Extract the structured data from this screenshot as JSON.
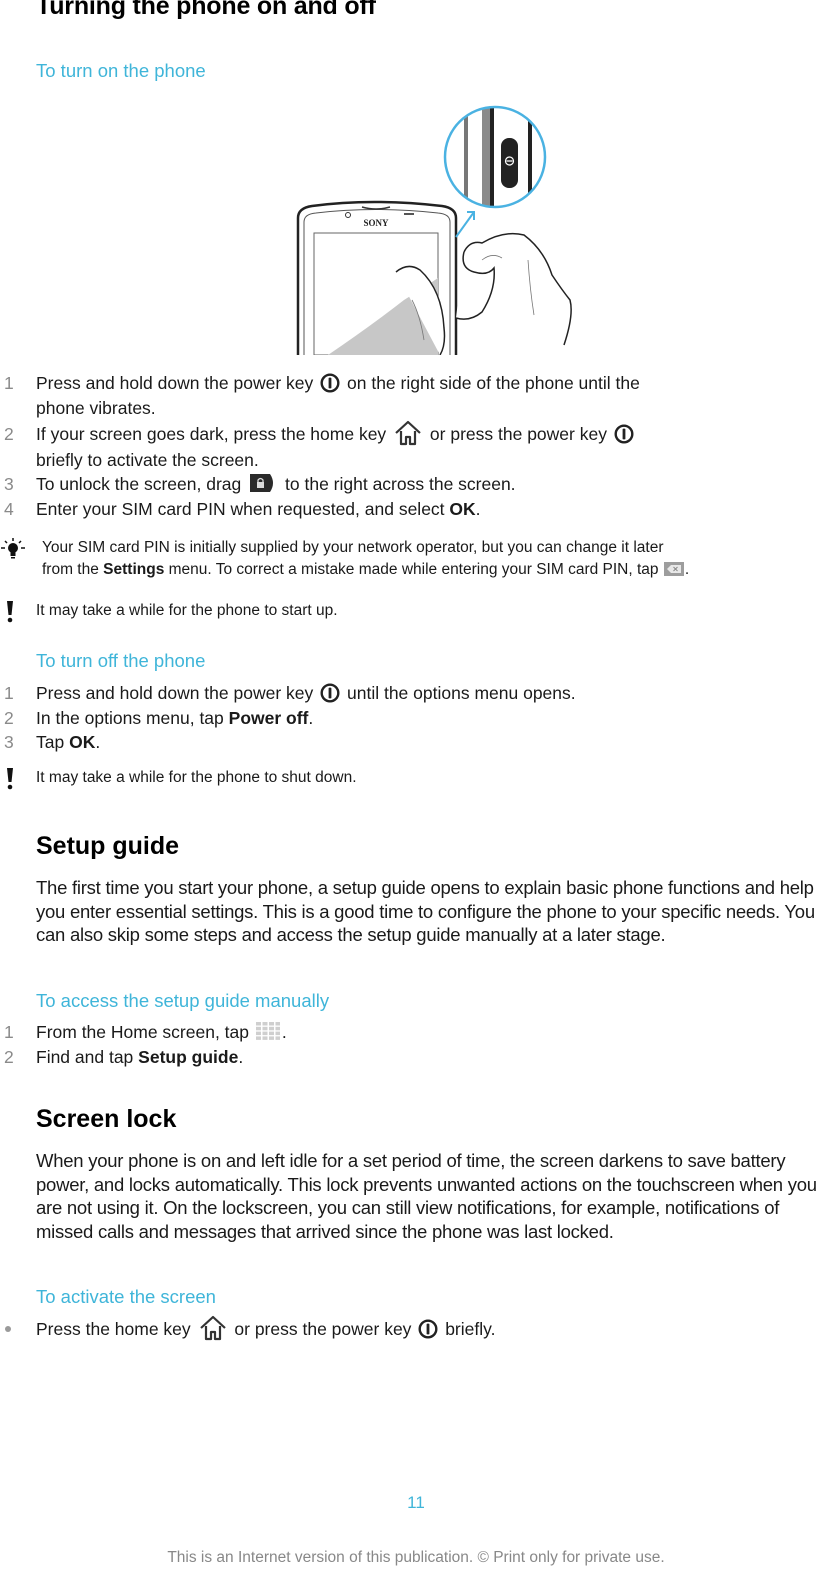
{
  "page_title": "Turning the phone on and off",
  "turn_on": {
    "heading": "To turn on the phone",
    "illustration": {
      "brand_label": "SONY",
      "highlight_color": "#4ab2e2"
    },
    "steps": [
      {
        "num": "1",
        "parts": [
          "Press and hold down the power key",
          "on the right side of the phone until the",
          "phone vibrates."
        ]
      },
      {
        "num": "2",
        "parts": [
          "If your screen goes dark, press the home key",
          "or press the power key",
          "briefly to activate the screen."
        ]
      },
      {
        "num": "3",
        "parts": [
          "To unlock the screen, drag",
          "to the right across the screen."
        ]
      },
      {
        "num": "4",
        "parts": [
          "Enter your SIM card PIN when requested, and select",
          "OK",
          "."
        ]
      }
    ],
    "tip": {
      "icon": "lightbulb-icon",
      "parts": [
        "Your SIM card PIN is initially supplied by your network operator, but you can change it later",
        "from the",
        "Settings",
        "menu. To correct a mistake made while entering your SIM card PIN, tap",
        "."
      ]
    },
    "warning": {
      "icon": "exclamation-icon",
      "text": "It may take a while for the phone to start up."
    }
  },
  "turn_off": {
    "heading": "To turn off the phone",
    "steps": [
      {
        "num": "1",
        "parts": [
          "Press and hold down the power key",
          "until the options menu opens."
        ]
      },
      {
        "num": "2",
        "parts": [
          "In the options menu, tap",
          "Power off",
          "."
        ]
      },
      {
        "num": "3",
        "parts": [
          "Tap",
          "OK",
          "."
        ]
      }
    ],
    "warning": {
      "icon": "exclamation-icon",
      "text": "It may take a while for the phone to shut down."
    }
  },
  "setup_guide": {
    "heading": "Setup guide",
    "body": "The first time you start your phone, a setup guide opens to explain basic phone functions and help you enter essential settings. This is a good time to configure the phone to your specific needs. You can also skip some steps and access the setup guide manually at a later stage.",
    "sub_heading": "To access the setup guide manually",
    "steps": [
      {
        "num": "1",
        "parts": [
          "From the Home screen, tap",
          "."
        ]
      },
      {
        "num": "2",
        "parts": [
          "Find and tap",
          "Setup guide",
          "."
        ]
      }
    ]
  },
  "screen_lock": {
    "heading": "Screen lock",
    "body": "When your phone is on and left idle for a set period of time, the screen darkens to save battery power, and locks automatically. This lock prevents unwanted actions on the touchscreen when you are not using it. On the lockscreen, you can still view notifications, for example, notifications of missed calls and messages that arrived since the phone was last locked.",
    "sub_heading": "To activate the screen",
    "bullet": {
      "parts": [
        "Press the home key",
        "or press the power key",
        "briefly."
      ]
    }
  },
  "page_number": "11",
  "footer": "This is an Internet version of this publication. © Print only for private use.",
  "colors": {
    "accent": "#3fb5d9",
    "step_number": "#8a8a8a",
    "text": "#1a1a1a"
  }
}
